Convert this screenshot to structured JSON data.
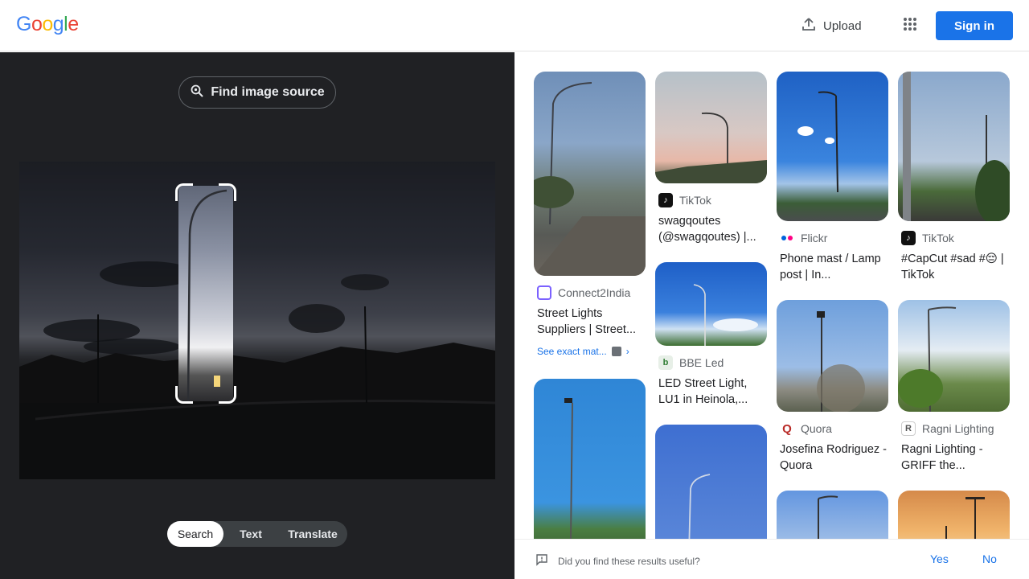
{
  "header": {
    "logo": [
      "G",
      "o",
      "o",
      "g",
      "l",
      "e"
    ],
    "logo_colors": [
      "#4285f4",
      "#ea4335",
      "#fbbc05",
      "#4285f4",
      "#34a853",
      "#ea4335"
    ],
    "upload_label": "Upload",
    "signin_label": "Sign in"
  },
  "left": {
    "find_source_label": "Find image source",
    "modes": [
      "Search",
      "Text",
      "Translate"
    ],
    "active_mode": "Search"
  },
  "results": [
    {
      "source": "Connect2India",
      "title": "Street Lights Suppliers | Street...",
      "exact_match": "See exact mat...",
      "favicon_color": "#1a73e8"
    },
    {
      "source": "TikTok",
      "title": "swagqoutes (@swagqoutes) |...",
      "favicon_color": "#111111"
    },
    {
      "source": "BBE Led",
      "title": "LED Street Light, LU1 in Heinola,...",
      "favicon_color": "#2e7d32"
    },
    {
      "source": "Flickr",
      "title": "Phone mast / Lamp post | In...",
      "favicon_color": "#ffffff"
    },
    {
      "source": "Quora",
      "title": "Josefina Rodriguez - Quora",
      "favicon_color": "#b92b27"
    },
    {
      "source": "TikTok",
      "title": "#CapCut #sad #😔 | TikTok",
      "favicon_color": "#111111"
    },
    {
      "source": "Ragni Lighting",
      "title": "Ragni Lighting - GRIFF the...",
      "favicon_color": "#ffffff"
    }
  ],
  "footer": {
    "question": "Did you find these results useful?",
    "yes": "Yes",
    "no": "No"
  }
}
